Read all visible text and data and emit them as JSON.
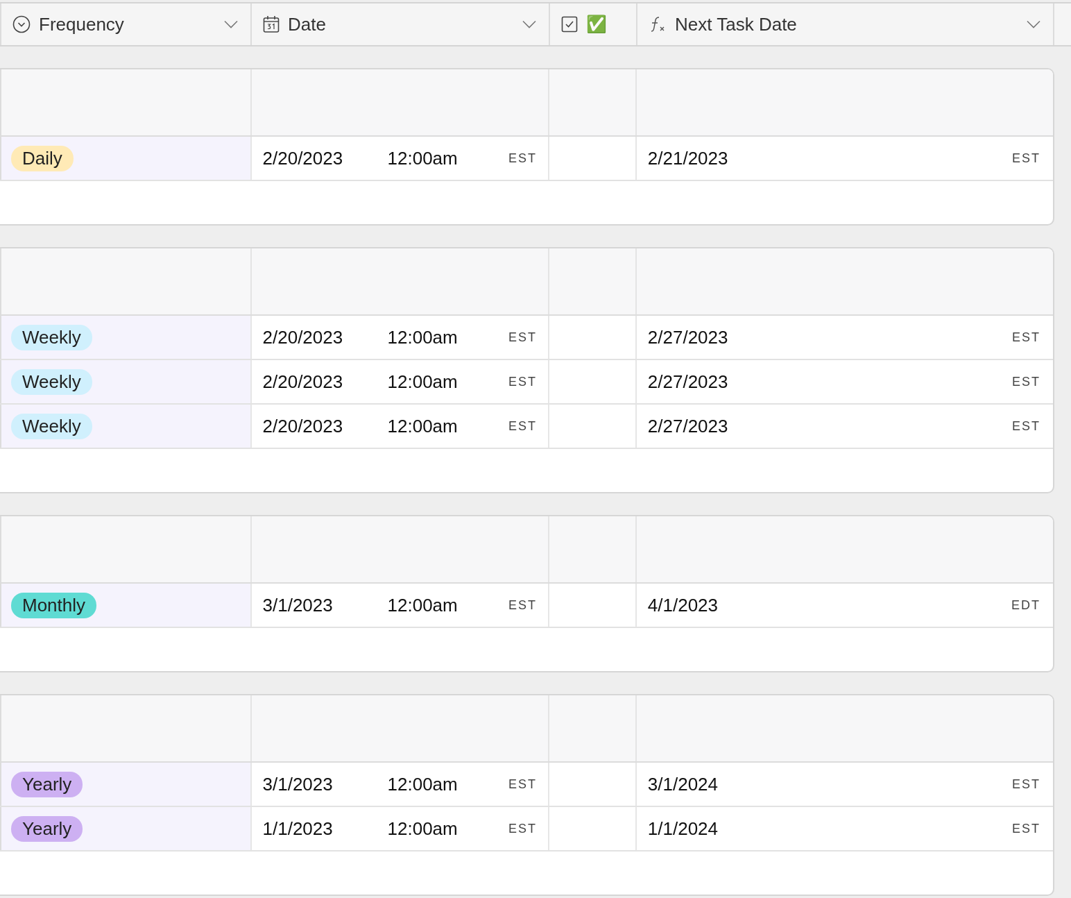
{
  "columns": [
    {
      "kind": "single-select",
      "label": "Frequency"
    },
    {
      "kind": "date",
      "label": "Date"
    },
    {
      "kind": "checkbox",
      "label": "✅"
    },
    {
      "kind": "formula",
      "label": "Next Task Date"
    }
  ],
  "groups": [
    {
      "rows": [
        {
          "frequency": {
            "label": "Daily",
            "color": "#ffeab6"
          },
          "date": "2/20/2023",
          "time": "12:00am",
          "tz": "EST",
          "next_date": "2/21/2023",
          "next_tz": "EST"
        }
      ]
    },
    {
      "rows": [
        {
          "frequency": {
            "label": "Weekly",
            "color": "#d0f0fd"
          },
          "date": "2/20/2023",
          "time": "12:00am",
          "tz": "EST",
          "next_date": "2/27/2023",
          "next_tz": "EST"
        },
        {
          "frequency": {
            "label": "Weekly",
            "color": "#d0f0fd"
          },
          "date": "2/20/2023",
          "time": "12:00am",
          "tz": "EST",
          "next_date": "2/27/2023",
          "next_tz": "EST"
        },
        {
          "frequency": {
            "label": "Weekly",
            "color": "#d0f0fd"
          },
          "date": "2/20/2023",
          "time": "12:00am",
          "tz": "EST",
          "next_date": "2/27/2023",
          "next_tz": "EST"
        }
      ]
    },
    {
      "rows": [
        {
          "frequency": {
            "label": "Monthly",
            "color": "#5fdbd3"
          },
          "date": "3/1/2023",
          "time": "12:00am",
          "tz": "EST",
          "next_date": "4/1/2023",
          "next_tz": "EDT"
        }
      ]
    },
    {
      "rows": [
        {
          "frequency": {
            "label": "Yearly",
            "color": "#cdb0f2"
          },
          "date": "3/1/2023",
          "time": "12:00am",
          "tz": "EST",
          "next_date": "3/1/2024",
          "next_tz": "EST"
        },
        {
          "frequency": {
            "label": "Yearly",
            "color": "#cdb0f2"
          },
          "date": "1/1/2023",
          "time": "12:00am",
          "tz": "EST",
          "next_date": "1/1/2024",
          "next_tz": "EST"
        }
      ]
    }
  ]
}
